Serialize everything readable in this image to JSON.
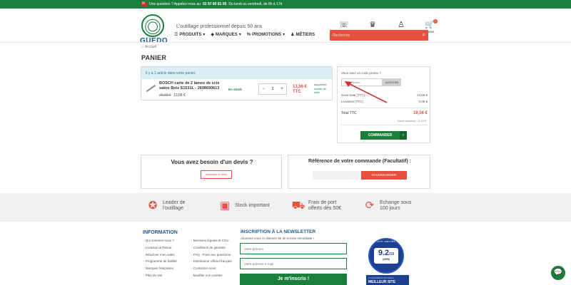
{
  "topbar": {
    "text_before": "Une question ? Appelez nous au",
    "phone": "02 97 60 81 05",
    "text_after": "Du lundi au vendredi, de 8h à 17h"
  },
  "header": {
    "logo_text": "GUEDO",
    "tagline": "L'outillage professionnel depuis 50 ans",
    "icons": [
      {
        "label": "Contactez-nous",
        "glyph": "☏"
      },
      {
        "label": "Fidélité",
        "glyph": "♛"
      },
      {
        "label": "Connexion",
        "glyph": "♙"
      },
      {
        "label": "Panier",
        "glyph": "🛒",
        "badge": "1"
      }
    ],
    "nav": [
      {
        "label": "PRODUITS",
        "glyph": "☰",
        "caret": "▾"
      },
      {
        "label": "MARQUES",
        "glyph": "◆",
        "caret": "▾"
      },
      {
        "label": "PROMOTIONS",
        "glyph": "%",
        "caret": "▾"
      },
      {
        "label": "MÉTIERS",
        "glyph": "♟",
        "caret": ""
      }
    ],
    "search_placeholder": "Recherche"
  },
  "breadcrumb": {
    "home_glyph": "⌂",
    "label": "Accueil"
  },
  "page_title": "PANIER",
  "cart": {
    "banner": "Il y a 1 article dans votre panier.",
    "item": {
      "name": "BOSCH carte de 2 lames de scie sabre Bois S1531L - 2608650613",
      "old_price": "20,80 €",
      "price": "13,56 €",
      "stock": "En stock",
      "quantity": "1",
      "minus": "−",
      "plus": "+",
      "line_total": "13,56 €",
      "line_total_suffix": "TTC",
      "remove_label": "supprimer",
      "wishlist_label": "mettre de côté"
    }
  },
  "summary": {
    "promo_label": "Vous avez un code promo ?",
    "promo_placeholder": "Code Promo",
    "promo_button": "AJOUTER",
    "subtotal_label": "Sous-total (TTC)",
    "subtotal_value": "13,56 €",
    "shipping_label": "Livraison (TTC)",
    "shipping_value": "0,00 €",
    "total_label": "Total TTC",
    "total_value": "19,56 €",
    "taxes": "Taxes incluses : 3,26 €",
    "order_button": "COMMANDER",
    "order_chevron": "›"
  },
  "devis": {
    "title": "Vous avez besoin d'un devis ?",
    "button": "demander un devis"
  },
  "reference": {
    "title": "Référence de votre commande (Facultatif) :",
    "button": "SAUVEGARDER"
  },
  "features": [
    {
      "line1": "Leader de",
      "line2": "l'outillage",
      "glyph": "✪"
    },
    {
      "line1": "Stock important",
      "line2": "",
      "glyph": "▣"
    },
    {
      "line1": "Frais de port",
      "line2": "offerts dès 50€",
      "glyph": "⛟"
    },
    {
      "line1": "Echange sous",
      "line2": "100 jours",
      "glyph": "⟳"
    }
  ],
  "footer": {
    "info_title": "INFORMATION",
    "col1": [
      "Qui sommes-nous ?",
      "Livraison & Retour",
      "Réactiver mon outils",
      "Programme de fidélité",
      "Marques françaises",
      "Plan du site"
    ],
    "col2": [
      "Mentions légales et CGV",
      "Conditions de garantie",
      "FAQ - Foire aux questions",
      "Distributeur officiel français",
      "Contactez-nous",
      "Modifier vos cookies"
    ],
    "newsletter_title": "INSCRIPTION À LA NEWSLETTER",
    "newsletter_sub": "Abonnez-vous et obtenez 5€ de remise immédiate !",
    "firstname_placeholder": "Votre prénom",
    "email_placeholder": "Votre adresse e-mail",
    "subscribe_button": "Je m'inscris !",
    "seal_ring": "AVIS VÉRIFIÉS",
    "seal_score": "9.2",
    "seal_max": "/10",
    "seal_count": "(1999)",
    "best_sub": "CLASSEMENT NATIONAL",
    "best_title": "MEILLEUR SITE"
  },
  "chat_glyph": "💬",
  "colors": {
    "green": "#1b7f3c",
    "red": "#e5503f",
    "blue": "#1b5a8a",
    "banner": "#d9eef5"
  }
}
